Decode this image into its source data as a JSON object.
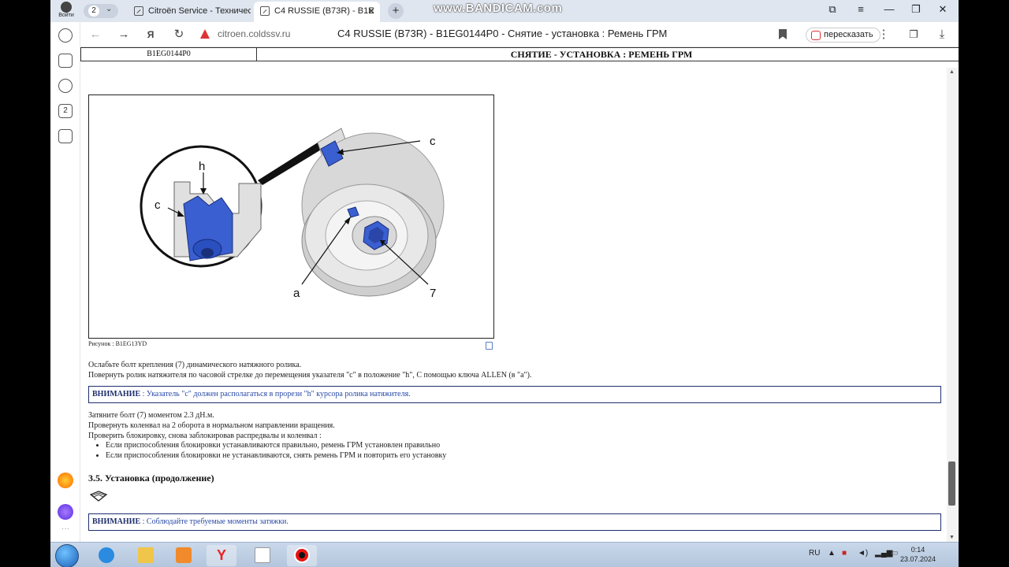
{
  "browser": {
    "profile_label": "Войти",
    "tab_count": "2",
    "tabs": [
      {
        "title": "Citroën Service - Техничес",
        "active": false
      },
      {
        "title": "C4 RUSSIE (B73R) - B1E",
        "active": true
      }
    ],
    "watermark": "www.BANDICAM.com",
    "url_host": "citroen.coldssv.ru",
    "page_title": "C4 RUSSIE (B73R) - B1EG0144P0 - Снятие - установка : Ремень ГРМ",
    "retell_label": "пересказать",
    "sidebar_badge": "2",
    "window_controls": [
      "⧉",
      "≡",
      "—",
      "❐",
      "✕"
    ]
  },
  "page": {
    "doc_code": "B1EG0144P0",
    "doc_title": "СНЯТИЕ - УСТАНОВКА : РЕМЕНЬ ГРМ",
    "figure": {
      "labels": {
        "c_top": "c",
        "h": "h",
        "c_left": "c",
        "a": "a",
        "seven": "7"
      },
      "caption": "Рисунок : B1EG13YD"
    },
    "para1": [
      "Ослабьте болт крепления (7) динамического натяжного ролика.",
      "Повернуть ролик натяжителя по часовой стрелке до перемещения указателя \"c\" в положение \"h\", С помощью ключа ALLEN (в \"a\")."
    ],
    "note1": {
      "label": "ВНИМАНИЕ",
      "text": " : Указатель \"c\" должен располагаться в прорези \"h\" курсора ролика натяжителя."
    },
    "para2": [
      "Затяните болт (7) моментом 2.3 дН.м.",
      "Провернуть коленвал на 2 оборота в нормальном направлении вращения.",
      "Проверить блокировку, снова заблокировав распредвалы и коленвал :"
    ],
    "bullets": [
      "Если приспособления блокировки устанавливаются правильно, ремень ГРМ установлен правильно",
      "Если приспособления блокировки не устанавливаются, снять ремень ГРМ и повторить его установку"
    ],
    "section_title": "3.5. Установка (продолжение)",
    "note2": {
      "label": "ВНИМАНИЕ",
      "text": " : Соблюдайте требуемые моменты затяжки."
    }
  },
  "taskbar": {
    "lang": "RU",
    "time": "0:14",
    "date": "23.07.2024"
  }
}
